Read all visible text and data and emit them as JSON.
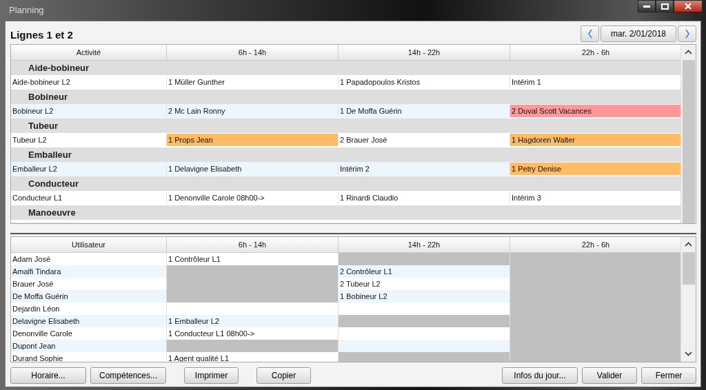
{
  "window": {
    "title": "Planning"
  },
  "heading": "Lignes 1 et 2",
  "date_nav": {
    "date": "mar. 2/01/2018"
  },
  "activity_table": {
    "columns": [
      "Activité",
      "6h - 14h",
      "14h - 22h",
      "22h - 6h"
    ],
    "groups": [
      {
        "name": "Aide-bobineur",
        "rows": [
          {
            "activity": "Aide-bobineur L2",
            "cells": [
              {
                "text": "1 Müller Gunther"
              },
              {
                "text": "1 Papadopoulos Kristos"
              },
              {
                "text": "Intérim 1"
              }
            ]
          }
        ]
      },
      {
        "name": "Bobineur",
        "rows": [
          {
            "activity": "Bobineur L2",
            "cells": [
              {
                "text": "2 Mc Lain Ronny"
              },
              {
                "text": "1 De Moffa Guérin"
              },
              {
                "text": "2 Duval Scott  Vacances",
                "color": "#ff9999"
              }
            ]
          }
        ]
      },
      {
        "name": "Tubeur",
        "rows": [
          {
            "activity": "Tubeur L2",
            "cells": [
              {
                "text": "1 Props Jean",
                "color": "#ffbb66"
              },
              {
                "text": "2 Brauer José"
              },
              {
                "text": "1 Hagdoren Walter",
                "color": "#ffbb66"
              }
            ]
          }
        ]
      },
      {
        "name": "Emballeur",
        "rows": [
          {
            "activity": "Emballeur L2",
            "cells": [
              {
                "text": "1 Delavigne Elisabeth"
              },
              {
                "text": "Intérim 2"
              },
              {
                "text": "1 Petry Denise",
                "color": "#ffbb66"
              }
            ]
          }
        ]
      },
      {
        "name": "Conducteur",
        "rows": [
          {
            "activity": "Conducteur L1",
            "cells": [
              {
                "text": "1 Denonville Carole 08h00->"
              },
              {
                "text": "1 Rinardi Claudio"
              },
              {
                "text": "Intérim 3"
              }
            ]
          }
        ]
      },
      {
        "name": "Manoeuvre"
      }
    ]
  },
  "user_table": {
    "columns": [
      "Utilisateur",
      "6h - 14h",
      "14h - 22h",
      "22h - 6h"
    ],
    "rows": [
      {
        "user": "Adam José",
        "cells": [
          {
            "text": "1 Contrôleur L1",
            "blocked": false
          },
          {
            "blocked": true
          },
          {
            "blocked": true
          }
        ]
      },
      {
        "user": "Amalfi Tindara",
        "cells": [
          {
            "blocked": true
          },
          {
            "text": "2 Contrôleur L1",
            "blocked": false
          },
          {
            "blocked": true
          }
        ]
      },
      {
        "user": "Brauer José",
        "cells": [
          {
            "blocked": true
          },
          {
            "text": "2 Tubeur L2",
            "blocked": false
          },
          {
            "blocked": true
          }
        ]
      },
      {
        "user": "De Moffa Guérin",
        "cells": [
          {
            "blocked": true
          },
          {
            "text": "1 Bobineur L2",
            "blocked": false
          },
          {
            "blocked": true
          }
        ]
      },
      {
        "user": "Dejardin Léon",
        "cells": [
          {
            "blocked": false
          },
          {
            "blocked": false
          },
          {
            "blocked": true
          }
        ]
      },
      {
        "user": "Delavigne Elisabeth",
        "cells": [
          {
            "text": "1 Emballeur L2",
            "blocked": false
          },
          {
            "blocked": true
          },
          {
            "blocked": true
          }
        ]
      },
      {
        "user": "Denonville Carole",
        "cells": [
          {
            "text": "1 Conducteur L1 08h00->",
            "blocked": false
          },
          {
            "blocked": false
          },
          {
            "blocked": true
          }
        ]
      },
      {
        "user": "Dupont Jean",
        "cells": [
          {
            "blocked": true
          },
          {
            "blocked": false
          },
          {
            "blocked": true
          }
        ]
      },
      {
        "user": "Durand Sophie",
        "cells": [
          {
            "text": "1 Agent qualité L1",
            "blocked": false
          },
          {
            "blocked": true
          },
          {
            "blocked": true
          }
        ]
      }
    ]
  },
  "buttons_left": [
    "Horaire...",
    "Compétences...",
    "Imprimer",
    "Copier"
  ],
  "buttons_right": [
    "Infos du jour...",
    "Valider",
    "Fermer"
  ]
}
